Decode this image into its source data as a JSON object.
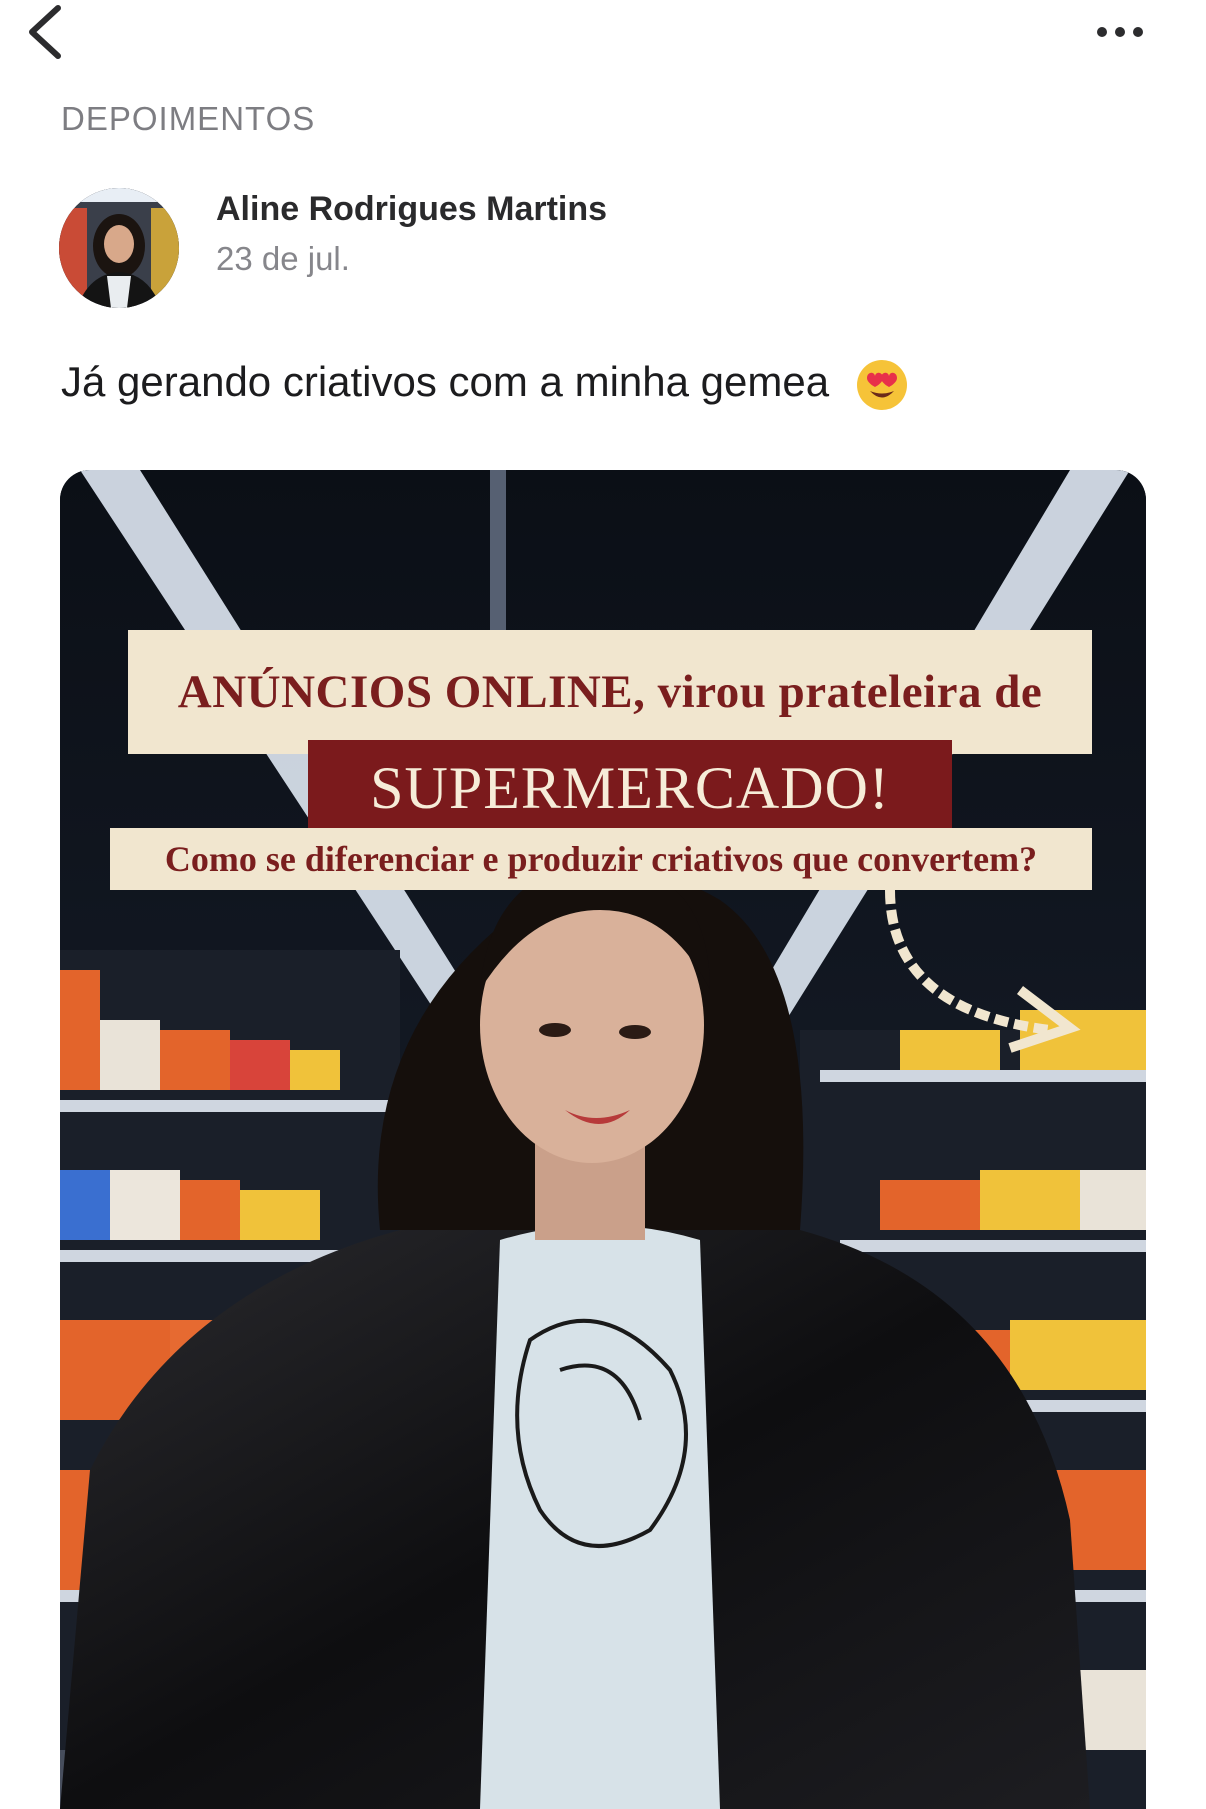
{
  "nav": {
    "back_icon": "chevron-left-icon",
    "more_icon": "ellipsis-icon"
  },
  "section": {
    "label": "DEPOIMENTOS"
  },
  "post": {
    "author": "Aline Rodrigues Martins",
    "date": "23 de jul.",
    "text": "Já gerando criativos com a minha gemea",
    "emoji": "heart-eyes-emoji"
  },
  "media": {
    "headline_1": "ANÚNCIOS ONLINE, virou prateleira de",
    "headline_2": "SUPERMERCADO!",
    "headline_3": "Como se  diferenciar e produzir criativos que convertem?",
    "colors": {
      "cream": "#f1e6cf",
      "maroon": "#7b1a1c"
    }
  }
}
